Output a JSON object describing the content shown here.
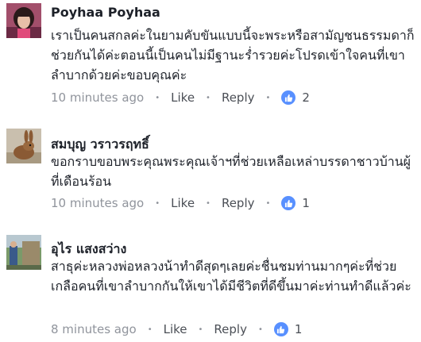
{
  "comments": [
    {
      "author": "Poyhaa Poyhaa",
      "text": "เราเป็นคนสกลค่ะในยามคับขันแบบนี้จะพระหรือสามัญชนธรรมดาก็ช่วยกันได้ค่ะตอนนี้เป็นคนไม่มีฐานะร่ำรวยค่ะโปรดเข้าใจคนที่เขาลำบากด้วยค่ะขอบคุณค่ะ",
      "time": "10 minutes ago",
      "like_label": "Like",
      "reply_label": "Reply",
      "reactions": "2",
      "avatar_icon": "profile-photo-woman"
    },
    {
      "author": "สมบุญ วราวรฤทธิ์",
      "text": "ขอกราบขอบพระคุณพระคุณเจ้าฯที่ช่วยเหลือเหล่าบรรดาชาวบ้านผู้ที่เดือนร้อน",
      "time": "10 minutes ago",
      "like_label": "Like",
      "reply_label": "Reply",
      "reactions": "1",
      "avatar_icon": "profile-photo-rabbit"
    },
    {
      "author": "อุไร แสงสว่าง",
      "text": "สาธุค่ะหลวงพ่อหลวงน้าทำดีสุดๆเลยค่ะชื่นชมท่านมากๆค่ะที่ช่วยเกลือคนที่เขาลำบากกันให้เขาได้มีชีวิตที่ดีขึ้นมาค่ะท่านทำดีแล้วค่ะ",
      "time": "8 minutes ago",
      "like_label": "Like",
      "reply_label": "Reply",
      "reactions": "1",
      "avatar_icon": "profile-photo-outdoor"
    }
  ],
  "colors": {
    "like_badge": "#5890ff",
    "meta_text": "#90949c",
    "name_text": "#1d2129"
  }
}
